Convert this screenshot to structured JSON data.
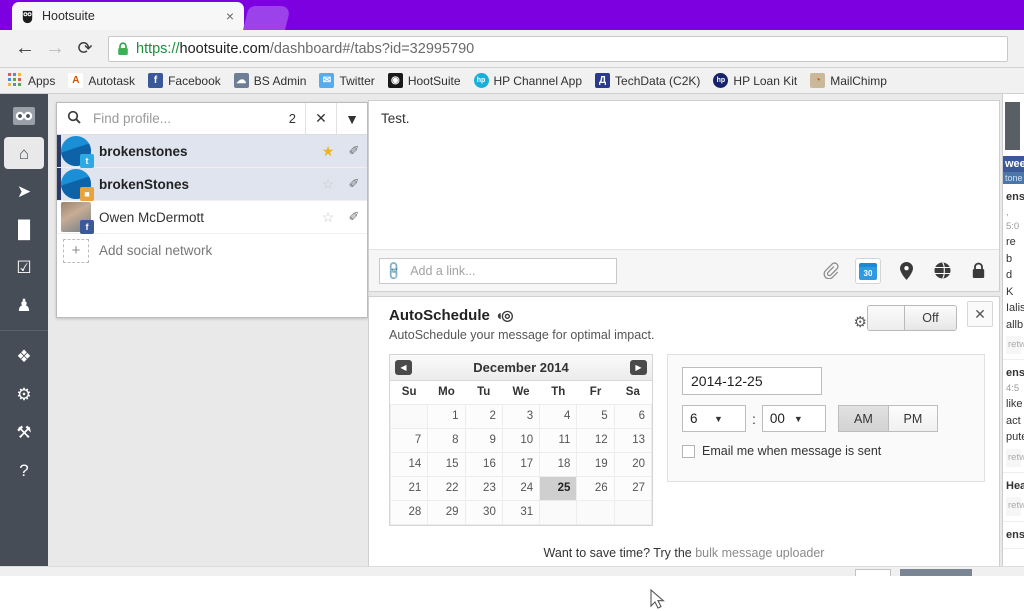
{
  "browser": {
    "tab": {
      "title": "Hootsuite",
      "favicon": "owl-icon",
      "close_label": "×"
    },
    "nav": {
      "back": "←",
      "forward": "→",
      "reload": "⟳"
    },
    "address": {
      "scheme": "https://",
      "host": "hootsuite.com",
      "path": "/dashboard#/tabs?id=32995790",
      "secure_icon": "lock-icon"
    },
    "bookmarks": [
      {
        "label": "Apps",
        "icon": "apps-grid-icon",
        "color": "#4a90d9"
      },
      {
        "label": "Autotask",
        "icon": "autotask-icon",
        "color": "#ffffff"
      },
      {
        "label": "Facebook",
        "icon": "facebook-icon",
        "color": "#3b5998"
      },
      {
        "label": "BS Admin",
        "icon": "cloud-icon",
        "color": "#6e7e96"
      },
      {
        "label": "Twitter",
        "icon": "twitter-icon",
        "color": "#55acee"
      },
      {
        "label": "HootSuite",
        "icon": "owl-icon",
        "color": "#1a1a1a"
      },
      {
        "label": "HP Channel App",
        "icon": "hp-icon",
        "color": "#18b0da"
      },
      {
        "label": "TechData (C2K)",
        "icon": "techdata-icon",
        "color": "#2a3a8c"
      },
      {
        "label": "HP Loan Kit",
        "icon": "hp-dark-icon",
        "color": "#16236b"
      },
      {
        "label": "MailChimp",
        "icon": "mailchimp-icon",
        "color": "#c9b89a"
      }
    ]
  },
  "rail": {
    "logo": "hootsuite-owl-logo",
    "items": [
      {
        "name": "streams",
        "icon": "home-icon",
        "glyph": "⌂",
        "active": true
      },
      {
        "name": "publisher",
        "icon": "send-icon",
        "glyph": "➤",
        "active": false
      },
      {
        "name": "analytics",
        "icon": "bar-chart-icon",
        "glyph": "█",
        "active": false
      },
      {
        "name": "assignments",
        "icon": "checkbox-icon",
        "glyph": "☑",
        "active": false
      },
      {
        "name": "contacts",
        "icon": "person-icon",
        "glyph": "♟",
        "active": false
      },
      {
        "name": "app-directory",
        "icon": "puzzle-icon",
        "glyph": "❖",
        "active": false
      },
      {
        "name": "settings",
        "icon": "gear-icon",
        "glyph": "⚙",
        "active": false
      },
      {
        "name": "tools",
        "icon": "wrench-icon",
        "glyph": "⚒",
        "active": false
      },
      {
        "name": "help",
        "icon": "question-icon",
        "glyph": "?",
        "active": false
      }
    ]
  },
  "profiles": {
    "search": {
      "placeholder": "Find profile...",
      "value": "",
      "count": "2",
      "clear_label": "✕",
      "caret_label": "▼",
      "icon": "search-icon"
    },
    "rows": [
      {
        "name": "brokenstones",
        "network": "twitter",
        "badge": "t",
        "badge_color": "#2daae1",
        "selected": true,
        "starred": true,
        "bold": true
      },
      {
        "name": "brokenStones",
        "network": "instagram",
        "badge": "■",
        "badge_color": "#e8a33d",
        "selected": true,
        "starred": false,
        "bold": true
      },
      {
        "name": "Owen McDermott",
        "network": "facebook",
        "badge": "f",
        "badge_color": "#3b5998",
        "selected": false,
        "starred": false,
        "bold": false
      }
    ],
    "add_label": "Add social network",
    "add_icon": "plus-icon",
    "star_on": "★",
    "star_off": "☆",
    "pin_icon": "✐"
  },
  "compose": {
    "message": "Test.",
    "link": {
      "placeholder": "Add a link...",
      "value": "",
      "icon": "paperclip-icon"
    },
    "tools": [
      {
        "name": "attach",
        "icon": "paperclip-icon",
        "glyph": "ὌE",
        "active": false
      },
      {
        "name": "schedule",
        "icon": "calendar-icon",
        "glyph": "30",
        "active": true
      },
      {
        "name": "location",
        "icon": "pin-icon",
        "glyph": "●",
        "active": false
      },
      {
        "name": "privacy",
        "icon": "globe-icon",
        "glyph": "◕",
        "active": false
      },
      {
        "name": "lock",
        "icon": "lock-icon",
        "glyph": "■",
        "active": false
      }
    ]
  },
  "autoschedule": {
    "title": "AutoSchedule",
    "signal_icon": "signal-icon",
    "subtitle": "AutoSchedule your message for optimal impact.",
    "gear_icon": "gear-icon",
    "toggle_state": "Off",
    "close_label": "✕",
    "calendar": {
      "month": "December 2014",
      "prev": "◀",
      "next": "▶",
      "weekdays": [
        "Su",
        "Mo",
        "Tu",
        "We",
        "Th",
        "Fr",
        "Sa"
      ],
      "weeks": [
        [
          "",
          "1",
          "2",
          "3",
          "4",
          "5",
          "6"
        ],
        [
          "7",
          "8",
          "9",
          "10",
          "11",
          "12",
          "13"
        ],
        [
          "14",
          "15",
          "16",
          "17",
          "18",
          "19",
          "20"
        ],
        [
          "21",
          "22",
          "23",
          "24",
          "25",
          "26",
          "27"
        ],
        [
          "28",
          "29",
          "30",
          "31",
          "",
          "",
          ""
        ]
      ],
      "selected_day": "25"
    },
    "datetime": {
      "date_value": "2014-12-25",
      "hour": "6",
      "minute": "00",
      "meridiem_options": [
        "AM",
        "PM"
      ],
      "meridiem_selected": "AM",
      "colon": ":",
      "email_label": "Email me when message is sent",
      "email_checked": false
    },
    "footer": {
      "text": "Want to save time? Try the ",
      "link": "bulk message uploader"
    }
  },
  "stream": {
    "band": "wee",
    "band_sub": "tone",
    "items": [
      {
        "title": "ens",
        "meta": ", 5:0",
        "lines": [
          "re b",
          "d K",
          "Ialis",
          "allb"
        ],
        "rt": "retw"
      },
      {
        "title": "ens",
        "meta": " 4:5",
        "lines": [
          "like",
          "act",
          "pute"
        ],
        "rt": "retw"
      },
      {
        "title": "Hea",
        "meta": "",
        "lines": [],
        "rt": "retw"
      },
      {
        "title": "ens",
        "meta": "",
        "lines": [],
        "rt": ""
      }
    ]
  }
}
